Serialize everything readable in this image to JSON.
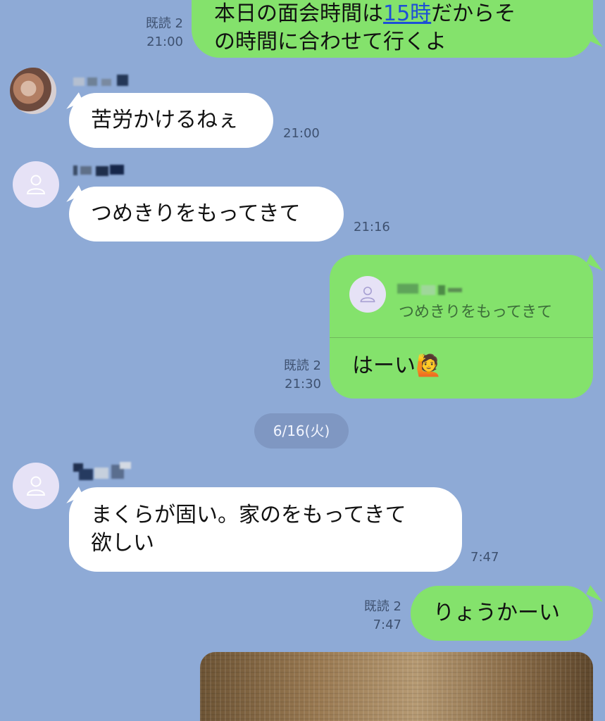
{
  "messages": [
    {
      "line1_pre": "本日の面会時間は",
      "line1_link": "15時",
      "line1_post": "だからそ",
      "line2": "の時間に合わせて行くよ",
      "read": "既読 2",
      "time": "21:00"
    },
    {
      "text": "苦労かけるねぇ",
      "time": "21:00"
    },
    {
      "text": "つめきりをもってきて",
      "time": "21:16"
    },
    {
      "quote_text": "つめきりをもってきて",
      "text": "はーい",
      "emoji": "🙋",
      "read": "既読 2",
      "time": "21:30"
    },
    {
      "line1": "まくらが固い。家のをもってきて",
      "line2": "欲しい",
      "time": "7:47"
    },
    {
      "text": "りょうかーい",
      "read": "既読 2",
      "time": "7:47"
    }
  ],
  "date_separator": "6/16(火)"
}
